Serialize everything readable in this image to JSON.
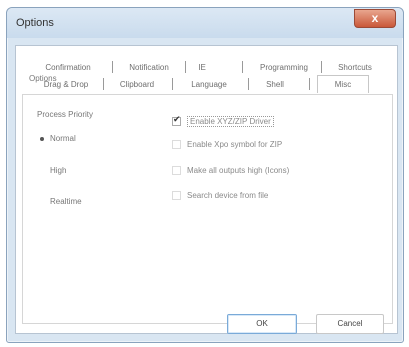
{
  "window": {
    "title": "Options",
    "close_glyph": "x"
  },
  "tabs_row1": [
    "Confirmation",
    "Notification",
    "IE",
    "Programming",
    "Shortcuts"
  ],
  "tabs_row2": [
    "Drag & Drop",
    "Clipboard",
    "Language",
    "Shell",
    "Misc"
  ],
  "active_tab": "Misc",
  "section_label": "Options",
  "process_priority": {
    "title": "Process Priority",
    "options": [
      "Normal",
      "High",
      "Realtime"
    ],
    "selected": "Normal"
  },
  "checkboxes": [
    {
      "label": "Enable XYZ/ZIP Driver",
      "checked": true
    },
    {
      "label": "Enable Xpo symbol for ZIP",
      "checked": false
    },
    {
      "label": "Make all outputs high (Icons)",
      "checked": false
    },
    {
      "label": "Search device from file",
      "checked": false
    }
  ],
  "buttons": {
    "ok": "OK",
    "cancel": "Cancel"
  },
  "colors": {
    "frame": "#d9e6f2",
    "close": "#c9583a",
    "accent": "#7aaad8"
  }
}
